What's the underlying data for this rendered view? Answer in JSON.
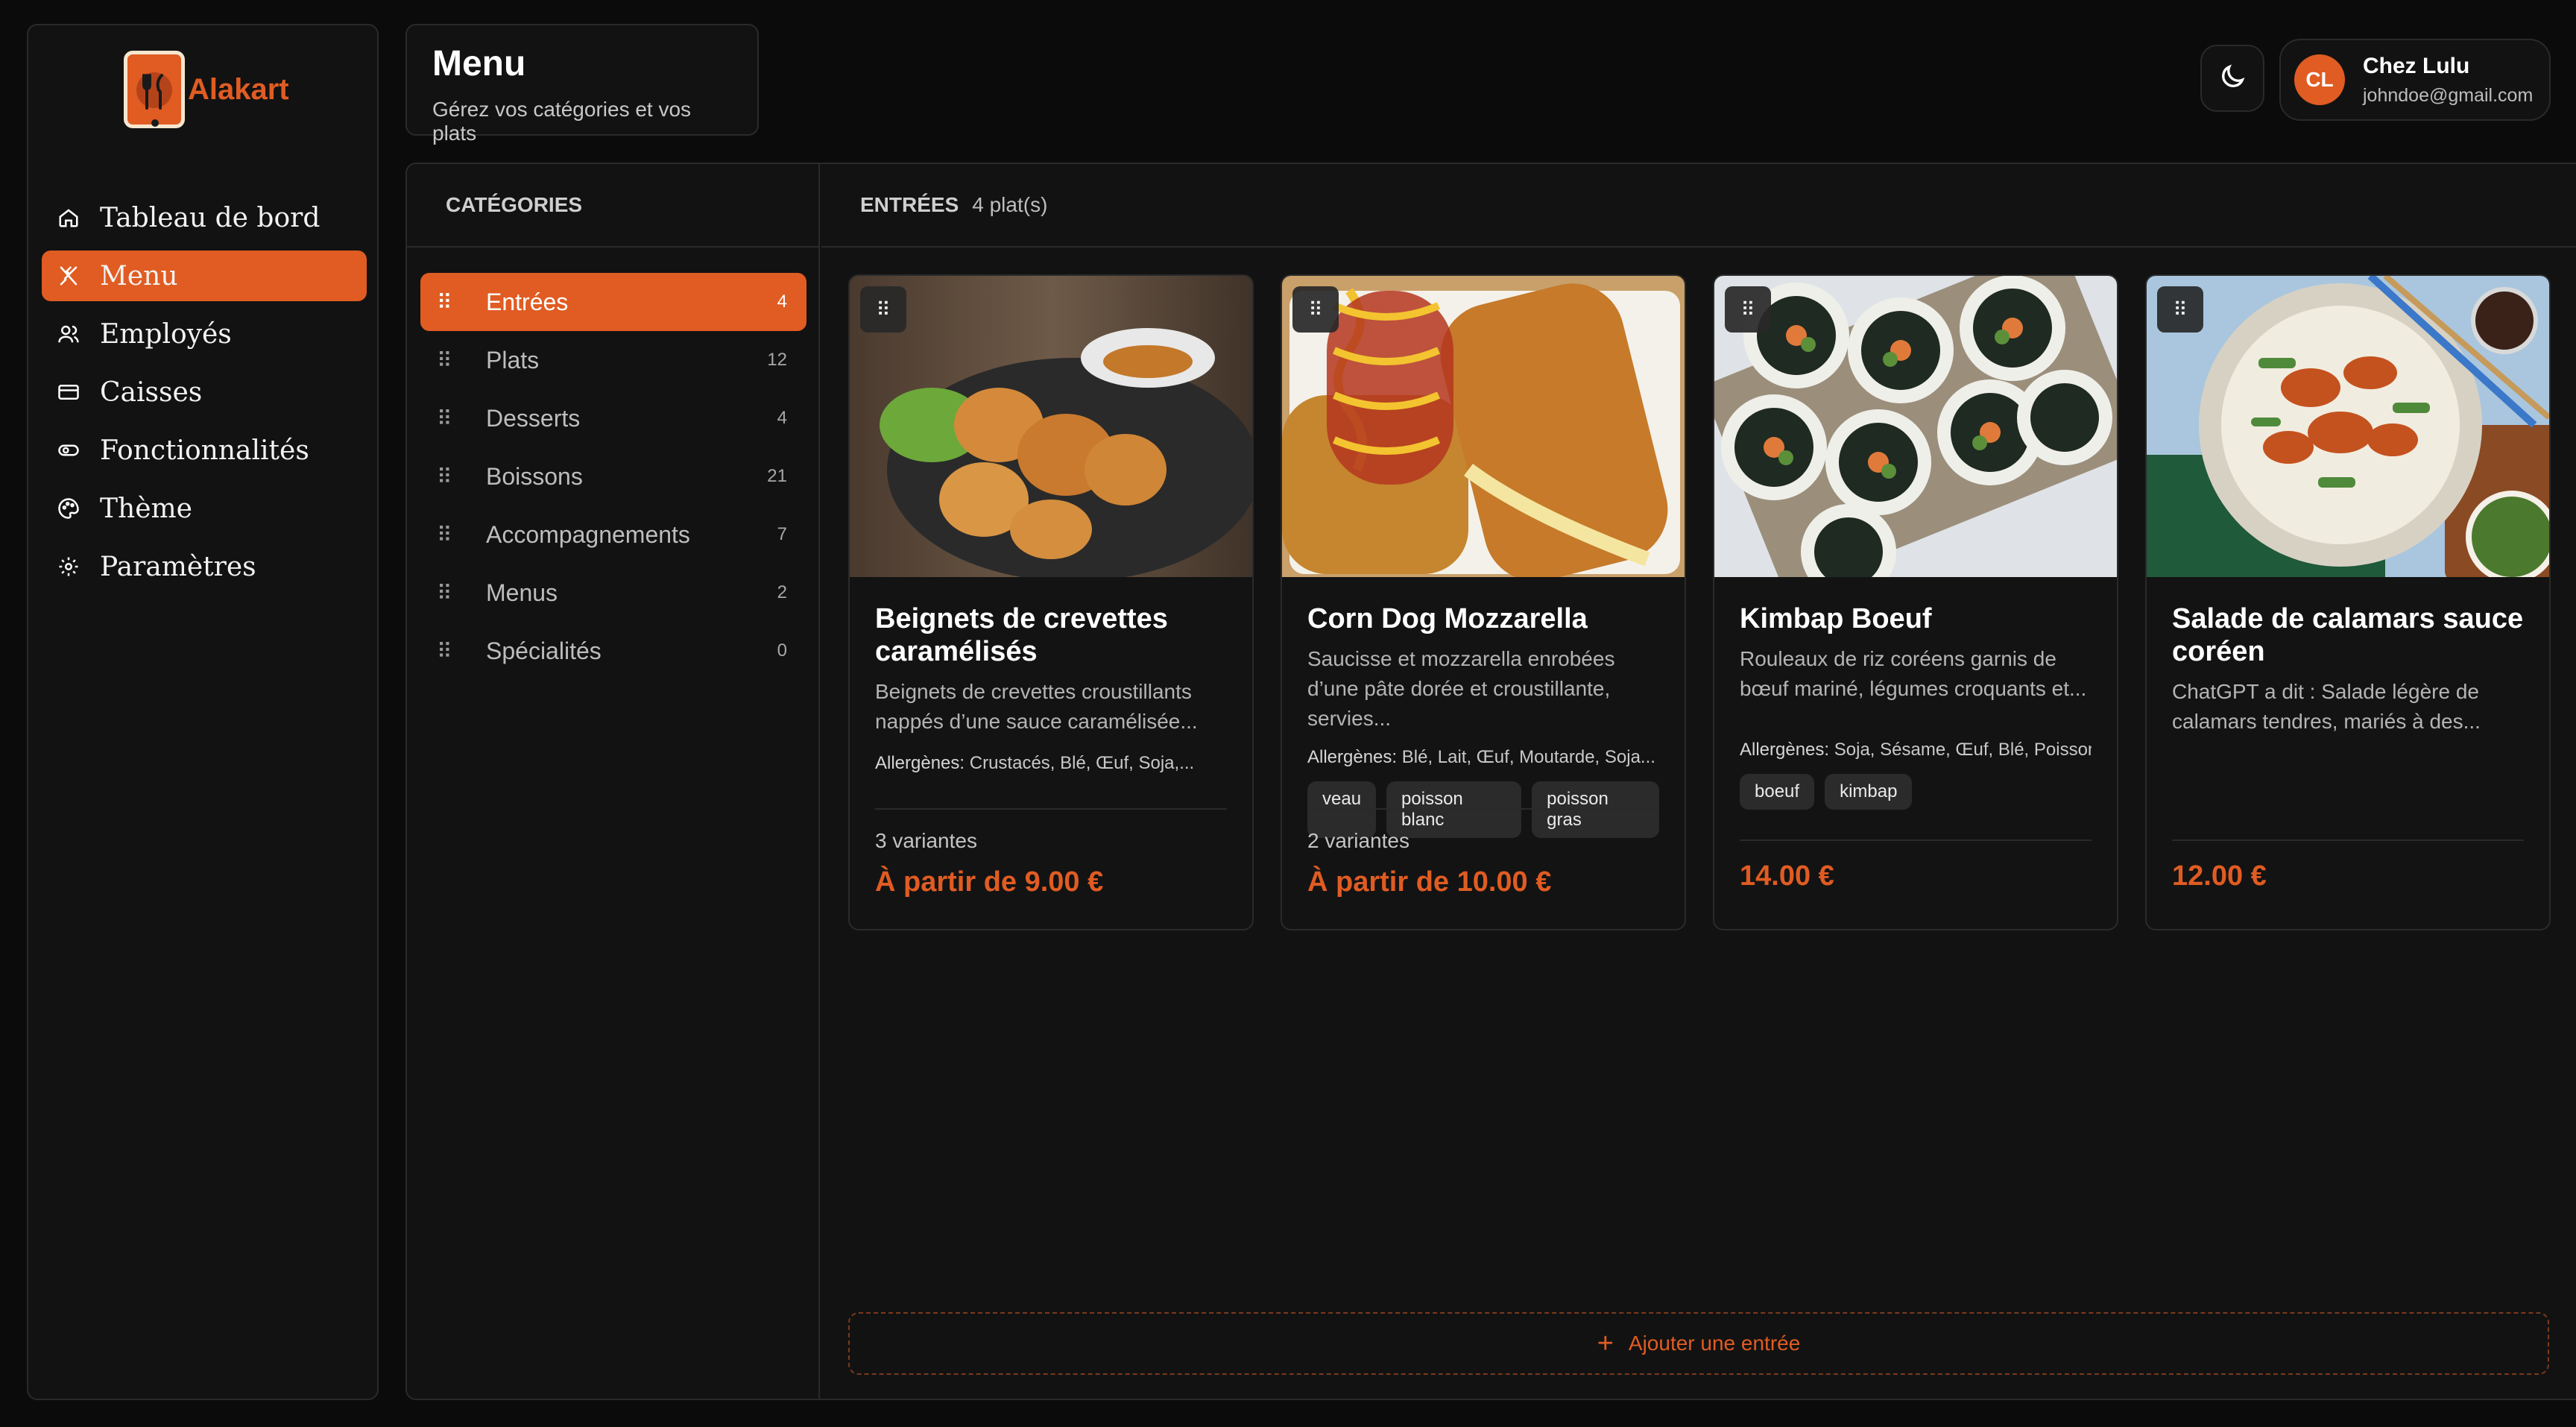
{
  "brand": {
    "name": "Alakart",
    "accent": "#e05c22"
  },
  "sidebar": {
    "items": [
      {
        "label": "Tableau de bord",
        "icon": "home-icon",
        "active": false
      },
      {
        "label": "Menu",
        "icon": "utensils-icon",
        "active": true
      },
      {
        "label": "Employés",
        "icon": "users-icon",
        "active": false
      },
      {
        "label": "Caisses",
        "icon": "credit-card-icon",
        "active": false
      },
      {
        "label": "Fonctionnalités",
        "icon": "toggle-icon",
        "active": false
      },
      {
        "label": "Thème",
        "icon": "palette-icon",
        "active": false
      },
      {
        "label": "Paramètres",
        "icon": "gear-icon",
        "active": false
      }
    ]
  },
  "header": {
    "title": "Menu",
    "subtitle": "Gérez vos catégories et vos plats"
  },
  "theme_toggle": {
    "icon": "moon-icon"
  },
  "user": {
    "initials": "CL",
    "name": "Chez Lulu",
    "email": "johndoe@gmail.com"
  },
  "categories": {
    "heading": "CATÉGORIES",
    "items": [
      {
        "name": "Entrées",
        "count": "4",
        "active": true
      },
      {
        "name": "Plats",
        "count": "12",
        "active": false
      },
      {
        "name": "Desserts",
        "count": "4",
        "active": false
      },
      {
        "name": "Boissons",
        "count": "21",
        "active": false
      },
      {
        "name": "Accompagnements",
        "count": "7",
        "active": false
      },
      {
        "name": "Menus",
        "count": "2",
        "active": false
      },
      {
        "name": "Spécialités",
        "count": "0",
        "active": false
      }
    ]
  },
  "items_panel": {
    "title": "ENTRÉES",
    "count": "4 plat(s)",
    "add_label": "Ajouter une entrée",
    "cards": [
      {
        "name": "Beignets de crevettes caramélisés",
        "description": "Beignets de crevettes croustillants nappés d’une sauce caramélisée...",
        "allergens_label": "Allergènes:",
        "allergens": "Crustacés, Blé, Œuf, Soja,...",
        "tags": [],
        "variants": "3 variantes",
        "price": "À partir de 9.00 €"
      },
      {
        "name": "Corn Dog Mozzarella",
        "description": "Saucisse et mozzarella enrobées d’une pâte dorée et croustillante, servies...",
        "allergens_label": "Allergènes:",
        "allergens": "Blé, Lait, Œuf, Moutarde, Soja...",
        "tags": [
          "veau",
          "poisson blanc",
          "poisson gras"
        ],
        "variants": "2 variantes",
        "price": "À partir de 10.00 €"
      },
      {
        "name": "Kimbap Boeuf",
        "description": "Rouleaux de riz coréens garnis de bœuf mariné, légumes croquants et...",
        "allergens_label": "Allergènes:",
        "allergens": "Soja, Sésame, Œuf, Blé, Poisson",
        "tags": [
          "boeuf",
          "kimbap"
        ],
        "variants": "",
        "price": "14.00 €"
      },
      {
        "name": "Salade de calamars sauce coréen",
        "description": "ChatGPT a dit : Salade légère de calamars tendres, mariés à des...",
        "allergens_label": "",
        "allergens": "",
        "tags": [],
        "variants": "",
        "price": "12.00 €"
      }
    ]
  }
}
